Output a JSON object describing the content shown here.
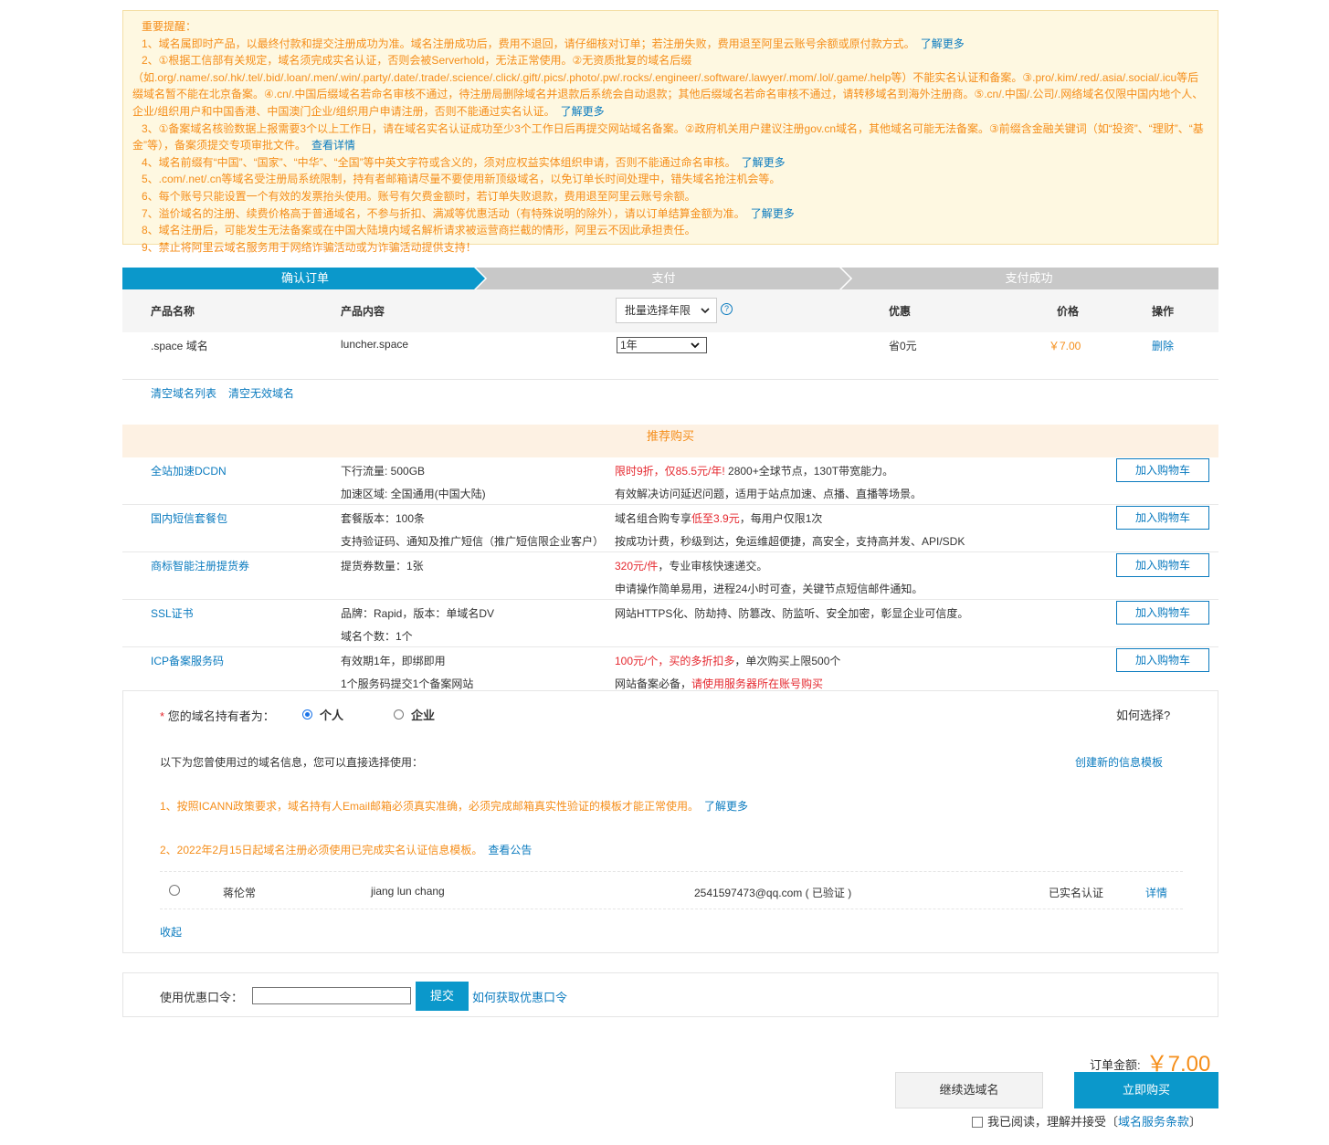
{
  "notice": {
    "title": "重要提醒：",
    "items": [
      {
        "text": "1、域名属即时产品，以最终付款和提交注册成功为准。域名注册成功后，费用不退回，请仔细核对订单；若注册失败，费用退至阿里云账号余额或原付款方式。",
        "link": "了解更多"
      },
      {
        "text": "2、①根据工信部有关规定，域名须完成实名认证，否则会被Serverhold，无法正常使用。②无资质批复的域名后缀（如.org/.name/.so/.hk/.tel/.bid/.loan/.men/.win/.party/.date/.trade/.science/.click/.gift/.pics/.photo/.pw/.rocks/.engineer/.software/.lawyer/.mom/.lol/.game/.help等）不能实名认证和备案。③.pro/.kim/.red/.asia/.social/.icu等后缀域名暂不能在北京备案。④.cn/.中国后缀域名若命名审核不通过，待注册局删除域名并退款后系统会自动退款；其他后缀域名若命名审核不通过，请转移域名到海外注册商。⑤.cn/.中国/.公司/.网络域名仅限中国内地个人、企业/组织用户和中国香港、中国澳门企业/组织用户申请注册，否则不能通过实名认证。",
        "link": "了解更多"
      },
      {
        "text": "3、①备案域名核验数据上报需要3个以上工作日，请在域名实名认证成功至少3个工作日后再提交网站域名备案。②政府机关用户建议注册gov.cn域名，其他域名可能无法备案。③前缀含金融关键词（如“投资”、“理财”、“基金”等），备案须提交专项审批文件。",
        "link": "查看详情"
      },
      {
        "text": "4、域名前缀有“中国”、“国家”、“中华”、“全国”等中英文字符或含义的，须对应权益实体组织申请，否则不能通过命名审核。",
        "link": "了解更多"
      },
      {
        "text": "5、.com/.net/.cn等域名受注册局系统限制，持有者邮箱请尽量不要使用新顶级域名，以免订单长时间处理中，错失域名抢注机会等。",
        "link": ""
      },
      {
        "text": "6、每个账号只能设置一个有效的发票抬头使用。账号有欠费金额时，若订单失败退款，费用退至阿里云账号余额。",
        "link": ""
      },
      {
        "text": "7、溢价域名的注册、续费价格高于普通域名，不参与折扣、满减等优惠活动（有特殊说明的除外），请以订单结算金额为准。",
        "link": "了解更多"
      },
      {
        "text": "8、域名注册后，可能发生无法备案或在中国大陆境内域名解析请求被运营商拦截的情形，阿里云不因此承担责任。",
        "link": ""
      },
      {
        "text": "9、禁止将阿里云域名服务用于网络诈骗活动或为诈骗活动提供支持！",
        "link": ""
      }
    ]
  },
  "steps": [
    "确认订单",
    "支付",
    "支付成功"
  ],
  "colors": {
    "active_step": "#0b98cb",
    "inactive_step": "#c8c8c8",
    "accent": "#0b7bbf",
    "price": "#f58e1a"
  },
  "order": {
    "headers": {
      "name": "产品名称",
      "content": "产品内容",
      "batch": "批量选择年限",
      "discount": "优惠",
      "price": "价格",
      "action": "操作"
    },
    "row": {
      "name": ".space 域名",
      "content": "luncher.space",
      "years": "1年",
      "discount": "省0元",
      "price": "￥7.00",
      "action": "删除"
    },
    "clear_list": "清空域名列表",
    "clear_invalid": "清空无效域名"
  },
  "recommend": {
    "title": "推荐购买",
    "button": "加入购物车",
    "items": [
      {
        "name": "全站加速DCDN",
        "spec1": "下行流量: 500GB",
        "spec2": "加速区域: 全国通用(中国大陆)",
        "desc1_red": "限时9折，仅85.5元/年!",
        "desc1": " 2800+全球节点，130T带宽能力。",
        "desc2": "有效解决访问延迟问题，适用于站点加速、点播、直播等场景。"
      },
      {
        "name": "国内短信套餐包",
        "spec1": "套餐版本：100条",
        "spec2": "支持验证码、通知及推广短信（推广短信限企业客户）",
        "desc1_pre": "域名组合购专享",
        "desc1_red": "低至3.9元",
        "desc1": "，每用户仅限1次",
        "desc2": "按成功计费，秒级到达，免运维超便捷，高安全，支持高并发、API/SDK"
      },
      {
        "name": "商标智能注册提货券",
        "spec1": "提货券数量：1张",
        "spec2": "",
        "desc1_red": "320元/件",
        "desc1": "，专业审核快速递交。",
        "desc2": "申请操作简单易用，进程24小时可查，关键节点短信邮件通知。"
      },
      {
        "name": "SSL证书",
        "spec1": "品牌：Rapid，版本：单域名DV",
        "spec2": "域名个数：1个",
        "desc1": "网站HTTPS化、防劫持、防篡改、防监听、安全加密，彰显企业可信度。",
        "desc2": ""
      },
      {
        "name": "ICP备案服务码",
        "spec1": "有效期1年，即绑即用",
        "spec2": "1个服务码提交1个备案网站",
        "desc1_red": "100元/个，买的多折扣多",
        "desc1": "，单次购买上限500个",
        "desc2_pre": "网站备案必备，",
        "desc2_red": "请使用服务器所在账号购买"
      }
    ]
  },
  "holder": {
    "required_mark": "*",
    "label": "您的域名持有者为：",
    "opt_personal": "个人",
    "opt_company": "企业",
    "how": "如何选择?",
    "info": "以下为您曾使用过的域名信息，您可以直接选择使用：",
    "create": "创建新的信息模板",
    "note1": "1、按照ICANN政策要求，域名持有人Email邮箱必须真实准确，必须完成邮箱真实性验证的模板才能正常使用。",
    "note1_link": "了解更多",
    "note2": "2、2022年2月15日起域名注册必须使用已完成实名认证信息模板。",
    "note2_link": "查看公告",
    "template": {
      "name": "蒋伦常",
      "pinyin": "jiang lun chang",
      "email": "2541597473@qq.com ( 已验证 )",
      "status": "已实名认证",
      "detail": "详情"
    },
    "collapse": "收起"
  },
  "coupon": {
    "label": "使用优惠口令：",
    "value": "",
    "submit": "提交",
    "how": "如何获取优惠口令"
  },
  "footer": {
    "total_label": "订单金额:",
    "total": "￥7.00",
    "continue": "继续选域名",
    "buy": "立即购买",
    "agree_pre": "我已阅读，理解并接受〔",
    "agree_link": "域名服务条款",
    "agree_post": "〕"
  }
}
